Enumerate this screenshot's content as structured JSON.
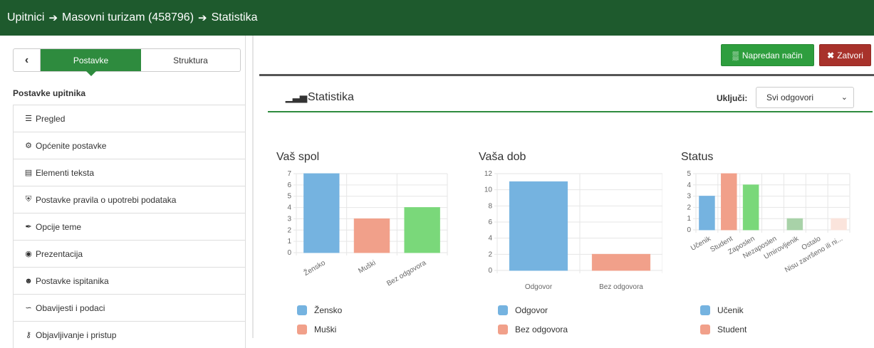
{
  "breadcrumb": {
    "items": [
      "Upitnici",
      "Masovni turizam (458796)",
      "Statistika"
    ],
    "separator": "➔"
  },
  "sidebar": {
    "tabs": {
      "back": "‹",
      "active": "Postavke",
      "other": "Struktura"
    },
    "heading": "Postavke upitnika",
    "items": [
      {
        "label": "Pregled",
        "icon": "list-icon"
      },
      {
        "label": "Općenite postavke",
        "icon": "cogs-icon"
      },
      {
        "label": "Elementi teksta",
        "icon": "file-text-icon"
      },
      {
        "label": "Postavke pravila o upotrebi podataka",
        "icon": "shield-icon"
      },
      {
        "label": "Opcije teme",
        "icon": "brush-icon"
      },
      {
        "label": "Prezentacija",
        "icon": "eye-slash-icon"
      },
      {
        "label": "Postavke ispitanika",
        "icon": "users-icon"
      },
      {
        "label": "Obavijesti i podaci",
        "icon": "rss-icon"
      },
      {
        "label": "Objavljivanje i pristup",
        "icon": "key-icon"
      }
    ]
  },
  "toolbar": {
    "advanced_label": "Napredan način",
    "close_label": "Zatvori"
  },
  "statistics": {
    "title": "Statistika",
    "include_label": "Uključi:",
    "include_value": "Svi odgovori"
  },
  "colors": {
    "blue": "#75b3e0",
    "salmon": "#f1a08a",
    "green": "#7ad87a",
    "grey_green": "#a8d2a8",
    "pale": "#fbe4dc"
  },
  "chart_data": [
    {
      "type": "bar",
      "title": "Vaš spol",
      "categories": [
        "Žensko",
        "Muški",
        "Bez odgovora"
      ],
      "values": [
        7,
        3,
        4
      ],
      "colors": [
        "#75b3e0",
        "#f1a08a",
        "#7ad87a"
      ],
      "ylim": [
        0,
        7
      ],
      "yticks": [
        0,
        1,
        2,
        3,
        4,
        5,
        6,
        7
      ],
      "legend": [
        "Žensko",
        "Muški"
      ]
    },
    {
      "type": "bar",
      "title": "Vaša dob",
      "categories": [
        "Odgovor",
        "Bez odgovora"
      ],
      "values": [
        11,
        2
      ],
      "colors": [
        "#75b3e0",
        "#f1a08a"
      ],
      "ylim": [
        0,
        12
      ],
      "yticks": [
        0,
        2,
        4,
        6,
        8,
        10,
        12
      ],
      "legend": [
        "Odgovor",
        "Bez odgovora"
      ]
    },
    {
      "type": "bar",
      "title": "Status",
      "categories": [
        "Učenik",
        "Student",
        "Zaposlen",
        "Nezaposlen",
        "Umirovljenik",
        "Ostalo",
        "Nisu završeno ili ni..."
      ],
      "values": [
        3,
        5,
        4,
        0,
        1,
        0,
        1
      ],
      "colors": [
        "#75b3e0",
        "#f1a08a",
        "#7ad87a",
        "#f1a08a",
        "#a8d2a8",
        "#75b3e0",
        "#fbe4dc"
      ],
      "ylim": [
        0,
        5
      ],
      "yticks": [
        0,
        1,
        2,
        3,
        4,
        5
      ],
      "legend": [
        "Učenik",
        "Student"
      ]
    }
  ]
}
